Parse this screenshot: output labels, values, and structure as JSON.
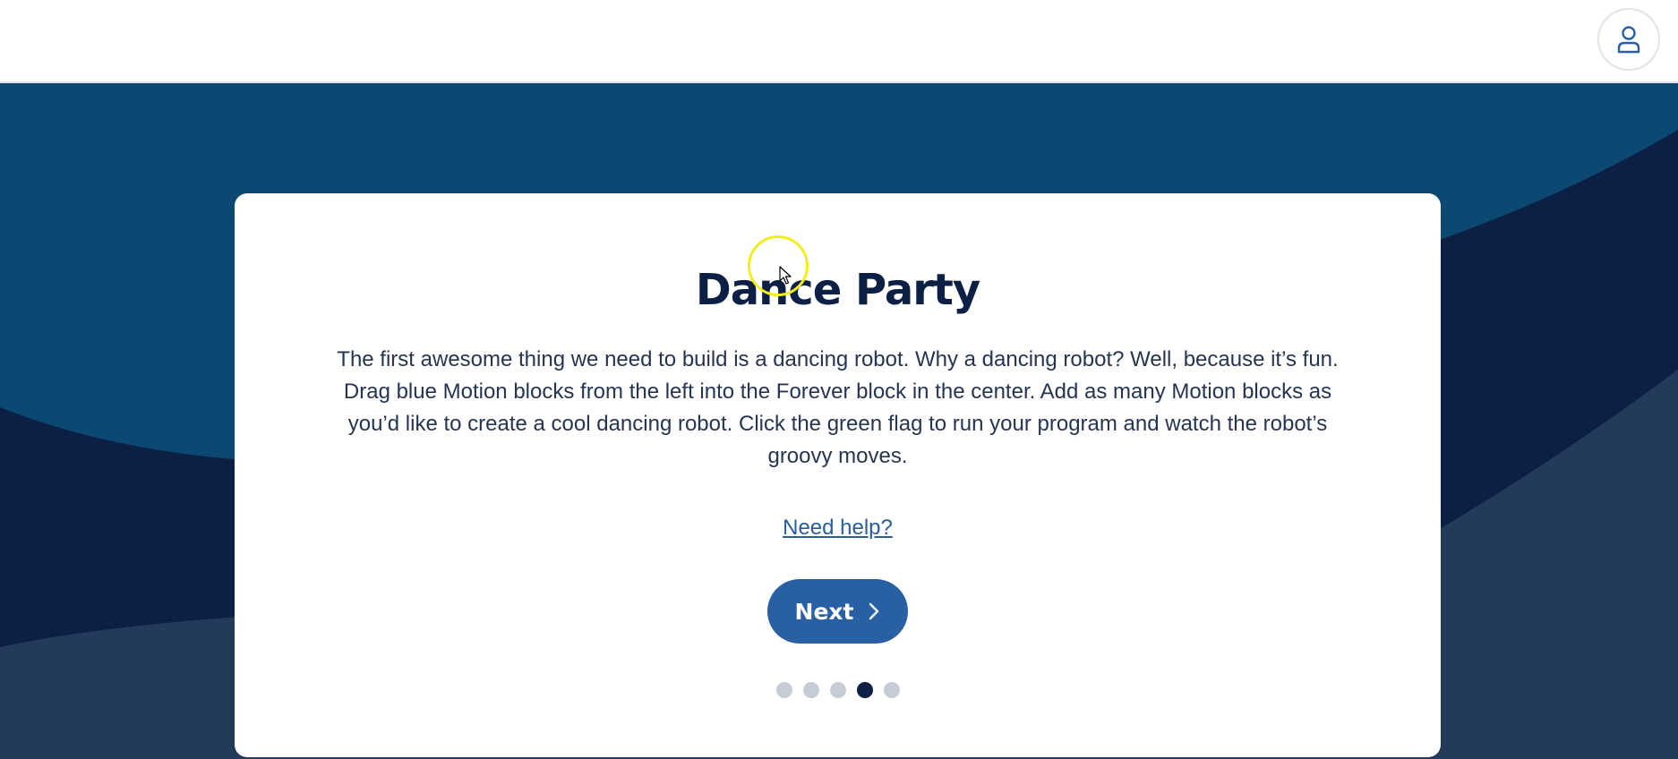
{
  "header": {
    "user_icon": "user-icon"
  },
  "colors": {
    "accent": "#2860a3",
    "title": "#0c1f45",
    "bg_top": "#0b4872",
    "bg_mid": "#0c1f45",
    "bg_bottom": "#243a5a",
    "dot_inactive": "#c5ccd6",
    "dot_active": "#0c1f45",
    "cursor_ring": "#f2ee1d"
  },
  "modal": {
    "title": "Dance Party",
    "description": "The first awesome thing we need to build is a dancing robot. Why a dancing robot? Well, because it’s fun. Drag blue Motion blocks from the left into the Forever block in the center. Add as many Motion blocks as you’d like to create a cool dancing robot. Click the green flag to run your program and watch the robot’s groovy moves.",
    "help_link": "Need help?",
    "next_label": "Next",
    "next_icon": "chevron-right-icon",
    "pagination": {
      "total": 5,
      "current": 4
    }
  }
}
